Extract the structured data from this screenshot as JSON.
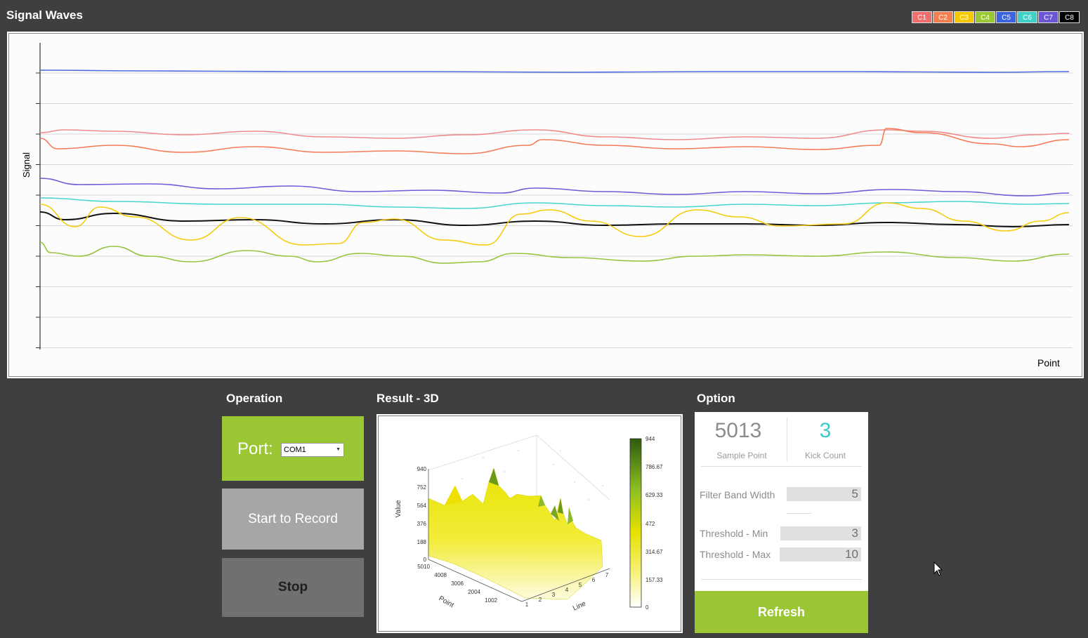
{
  "header": {
    "title": "Signal Waves"
  },
  "legend": [
    {
      "label": "C1",
      "color": "#f06e6e"
    },
    {
      "label": "C2",
      "color": "#f57f4e"
    },
    {
      "label": "C3",
      "color": "#f5c800"
    },
    {
      "label": "C4",
      "color": "#9ac733"
    },
    {
      "label": "C5",
      "color": "#3d64e0"
    },
    {
      "label": "C6",
      "color": "#3fd1c8"
    },
    {
      "label": "C7",
      "color": "#6b56d6"
    },
    {
      "label": "C8",
      "color": "#000000"
    }
  ],
  "waves": {
    "ylabel": "Signal",
    "xlabel": "Point",
    "grid_lines": 10,
    "series_colors": [
      "#4a6ce0",
      "#f08a8a",
      "#f57b56",
      "#6f5ad8",
      "#46d6cc",
      "#111111",
      "#f5cc10",
      "#95c43e"
    ]
  },
  "operation": {
    "title": "Operation",
    "port_label": "Port:",
    "port_value": "COM1",
    "start_label": "Start to Record",
    "stop_label": "Stop"
  },
  "result": {
    "title": "Result - 3D",
    "ylabel": "Value",
    "xlabel_point": "Point",
    "xlabel_line": "Line",
    "value_ticks": [
      "940",
      "752",
      "564",
      "376",
      "188",
      "0"
    ],
    "point_ticks": [
      "5010",
      "4008",
      "3006",
      "2004",
      "1002"
    ],
    "line_ticks": [
      "1",
      "2",
      "3",
      "4",
      "5",
      "6",
      "7"
    ],
    "colorbar_ticks": [
      "944",
      "786.67",
      "629.33",
      "472",
      "314.67",
      "157.33",
      "0"
    ]
  },
  "option": {
    "title": "Option",
    "sample_point_value": "5013",
    "sample_point_label": "Sample Point",
    "kick_count_value": "3",
    "kick_count_label": "Kick Count",
    "filter_band_width_label": "Filter Band Width",
    "filter_band_width_value": "5",
    "threshold_min_label": "Threshold - Min",
    "threshold_min_value": "3",
    "threshold_max_label": "Threshold - Max",
    "threshold_max_value": "10",
    "refresh_label": "Refresh"
  }
}
